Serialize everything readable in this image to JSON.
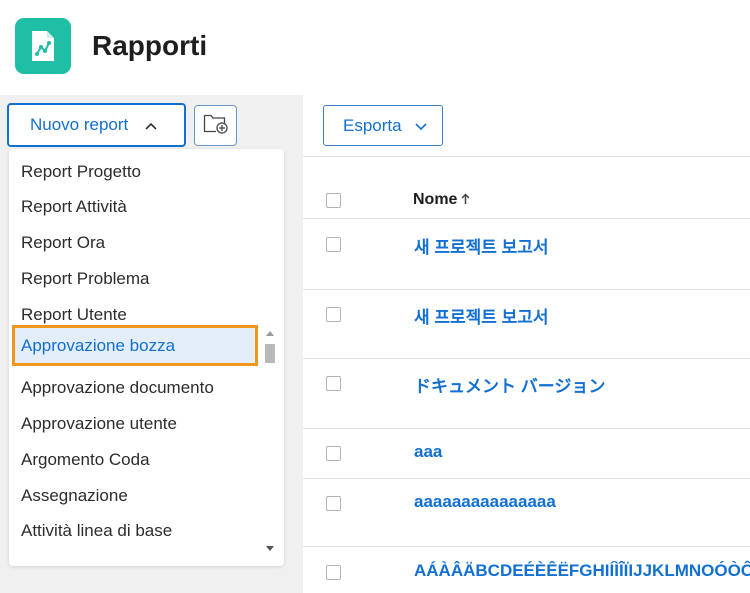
{
  "header": {
    "title": "Rapporti",
    "logo_icon": "report-chart-icon",
    "logo_color": "#1fbfa6"
  },
  "left": {
    "new_report_label": "Nuovo report",
    "new_report_icon": "chevron-up-icon",
    "folder_icon": "folder-add-icon",
    "menu_items": [
      "Report Progetto",
      "Report Attività",
      "Report Ora",
      "Report Problema",
      "Report Utente",
      "Approvazione bozza",
      "Approvazione documento",
      "Approvazione utente",
      "Argomento Coda",
      "Assegnazione",
      "Attività linea di base"
    ],
    "selected_item": "Approvazione bozza"
  },
  "right": {
    "export_label": "Esporta",
    "export_icon": "chevron-down-icon",
    "column_name": "Nome",
    "sort_icon": "sort-ascending-arrow-icon",
    "rows": [
      "새 프로젝트 보고서",
      "새 프로젝트 보고서",
      "ドキュメント バージョン",
      "aaa",
      "aaaaaaaaaaaaaaa",
      "AÁÀÂÄBCDEÉÈÊËFGHIÍÌÎÏIJJKLMNOÓÒÔÖ"
    ]
  },
  "colors": {
    "accent": "#1370d3",
    "highlight_border": "#f0961c",
    "highlight_bg": "#e3eefa"
  }
}
